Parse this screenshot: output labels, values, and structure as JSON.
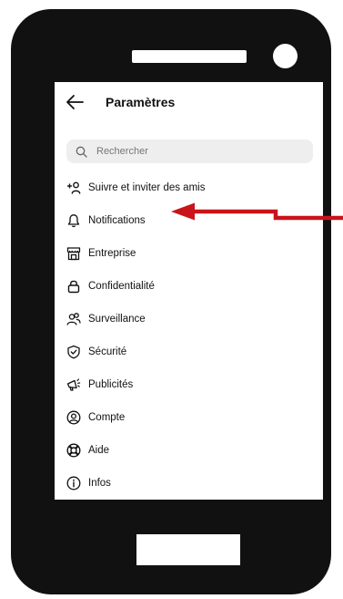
{
  "header": {
    "title": "Paramètres",
    "back_icon": "arrow-left-icon"
  },
  "search": {
    "placeholder": "Rechercher",
    "icon": "search-icon"
  },
  "menu": {
    "items": [
      {
        "label": "Suivre et inviter des amis",
        "icon": "add-person-icon"
      },
      {
        "label": "Notifications",
        "icon": "bell-icon"
      },
      {
        "label": "Entreprise",
        "icon": "storefront-icon"
      },
      {
        "label": "Confidentialité",
        "icon": "lock-icon"
      },
      {
        "label": "Surveillance",
        "icon": "people-icon"
      },
      {
        "label": "Sécurité",
        "icon": "shield-check-icon"
      },
      {
        "label": "Publicités",
        "icon": "megaphone-icon"
      },
      {
        "label": "Compte",
        "icon": "account-circle-icon"
      },
      {
        "label": "Aide",
        "icon": "lifebuoy-icon"
      },
      {
        "label": "Infos",
        "icon": "info-icon"
      }
    ]
  },
  "annotation": {
    "color": "#c8141a",
    "icon": "red-pointer-arrow"
  },
  "colors": {
    "phone_body": "#111111",
    "search_bg": "#eeeeee"
  }
}
